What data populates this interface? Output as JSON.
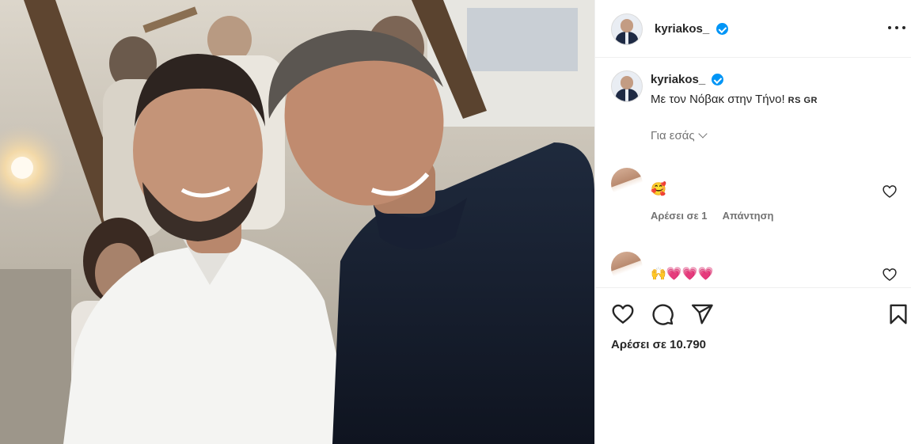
{
  "post": {
    "username": "kyriakos_",
    "caption": "Με τον Νόβακ στην Τήνο!",
    "caption_flags": "RS GR",
    "translate_label": "Για εσάς",
    "likes_label": "Αρέσει σε 10.790"
  },
  "comments": [
    {
      "username": "",
      "text": "🥰",
      "likes_label": "Αρέσει σε 1",
      "reply_label": "Απάντηση"
    },
    {
      "username": "",
      "text": "🙌💗💗💗"
    }
  ],
  "icons": {
    "header_more": "more-horizontal-icon",
    "verified": "verified-badge-icon",
    "like": "heart-outline-icon",
    "comment": "comment-bubble-icon",
    "share": "paper-plane-icon",
    "save": "bookmark-icon"
  },
  "colors": {
    "verified_blue": "#0095f6",
    "text_primary": "#262626",
    "text_secondary": "#737373",
    "divider": "#efefef"
  }
}
